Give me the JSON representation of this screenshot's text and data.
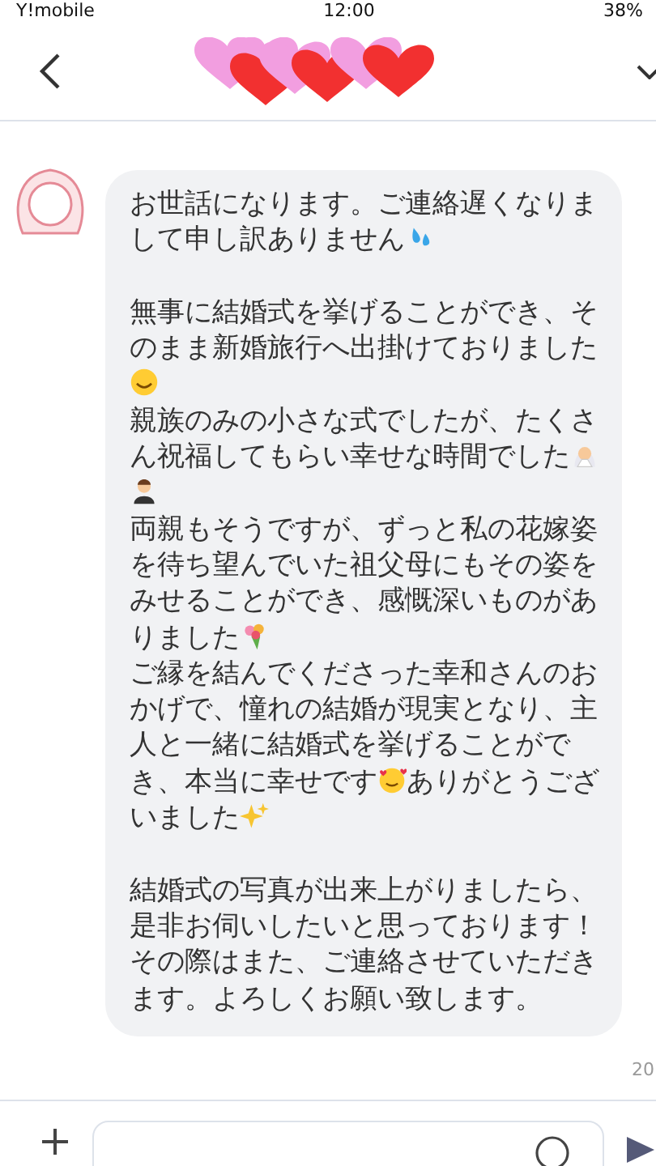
{
  "status_bar": {
    "carrier": "Y!mobile",
    "time": "12:00",
    "battery": "38%"
  },
  "message": {
    "paragraphs": [
      [
        [
          {
            "kind": "text",
            "text": "お世話になります。ご連絡遅くなりまして申し訳ありません"
          },
          {
            "kind": "droplets"
          }
        ]
      ],
      [
        [
          {
            "kind": "text",
            "text": "無事に結婚式を挙げることができ、そのまま新婚旅行へ出掛けておりました"
          },
          {
            "kind": "smile"
          }
        ],
        [
          {
            "kind": "text",
            "text": "親族のみの小さな式でしたが、たくさん祝福してもらい幸せな時間でした"
          },
          {
            "kind": "bride"
          },
          {
            "kind": "groom"
          }
        ],
        [
          {
            "kind": "text",
            "text": "両親もそうですが、ずっと私の花嫁姿を待ち望んでいた祖父母にもその姿をみせることができ、感慨深いものがありました"
          },
          {
            "kind": "bouquet"
          }
        ],
        [
          {
            "kind": "text",
            "text": "ご縁を結んでくださった幸和さんのおかげで、憧れの結婚が現実となり、主人と一緒に結婚式を挙げることができ、本当に幸せです"
          },
          {
            "kind": "blush"
          },
          {
            "kind": "text",
            "text": "ありがとうございました"
          },
          {
            "kind": "sparkles"
          }
        ]
      ],
      [
        [
          {
            "kind": "text",
            "text": "結婚式の写真が出来上がりましたら、是非お伺いしたいと思っております！その際はまた、ご連絡させていただきます。よろしくお願い致します。"
          }
        ]
      ]
    ],
    "time": "20"
  }
}
